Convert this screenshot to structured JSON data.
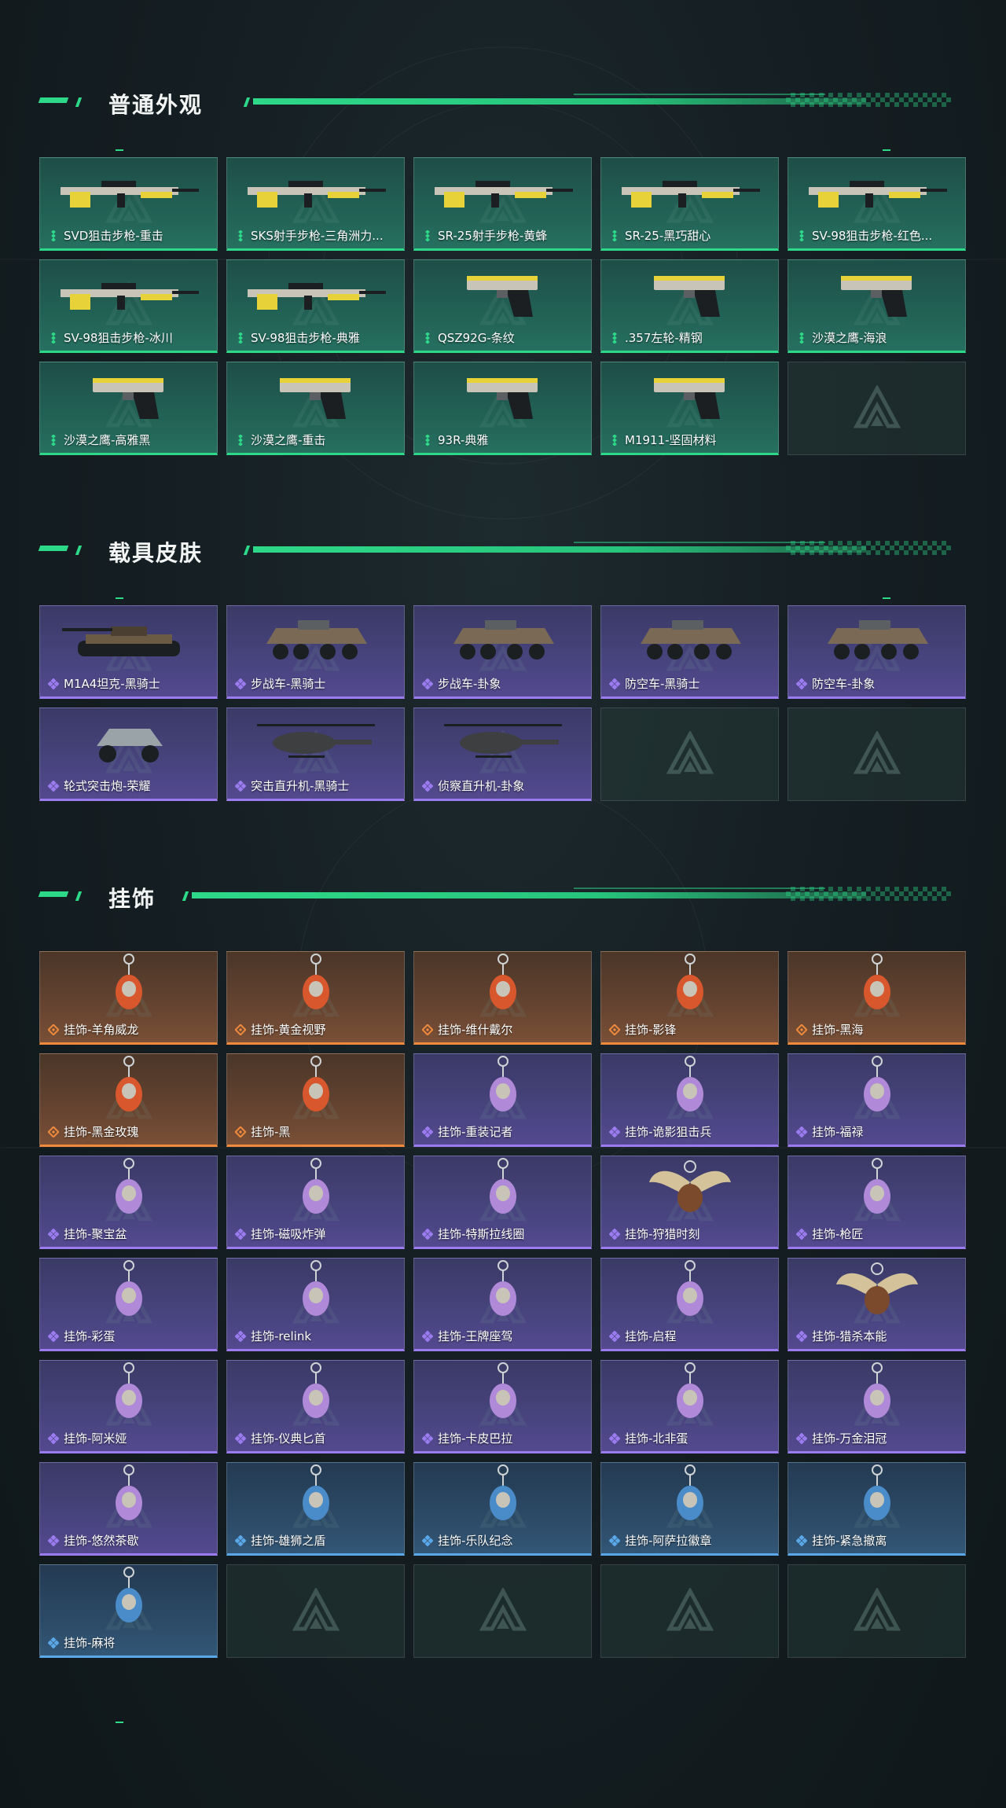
{
  "sections": [
    {
      "title": "普通外观",
      "items": [
        {
          "label": "SVD狙击步枪-重击",
          "rarity": "green",
          "icon": "rifle-icon"
        },
        {
          "label": "SKS射手步枪-三角洲力...",
          "rarity": "green",
          "icon": "rifle-icon"
        },
        {
          "label": "SR-25射手步枪-黄蜂",
          "rarity": "green",
          "icon": "rifle-icon"
        },
        {
          "label": "SR-25-黑巧甜心",
          "rarity": "green",
          "icon": "rifle-icon"
        },
        {
          "label": "SV-98狙击步枪-红色...",
          "rarity": "green",
          "icon": "rifle-icon"
        },
        {
          "label": "SV-98狙击步枪-冰川",
          "rarity": "green",
          "icon": "rifle-icon"
        },
        {
          "label": "SV-98狙击步枪-典雅",
          "rarity": "green",
          "icon": "rifle-icon"
        },
        {
          "label": "QSZ92G-条纹",
          "rarity": "green",
          "icon": "pistol-icon"
        },
        {
          "label": ".357左轮-精钢",
          "rarity": "green",
          "icon": "revolver-icon"
        },
        {
          "label": "沙漠之鹰-海浪",
          "rarity": "green",
          "icon": "pistol-icon"
        },
        {
          "label": "沙漠之鹰-高雅黑",
          "rarity": "green",
          "icon": "pistol-icon"
        },
        {
          "label": "沙漠之鹰-重击",
          "rarity": "green",
          "icon": "pistol-icon"
        },
        {
          "label": "93R-典雅",
          "rarity": "green",
          "icon": "pistol-icon"
        },
        {
          "label": "M1911-坚固材料",
          "rarity": "green",
          "icon": "pistol-icon"
        },
        {
          "label": "",
          "rarity": "empty",
          "icon": "logo-watermark-icon"
        }
      ]
    },
    {
      "title": "载具皮肤",
      "items": [
        {
          "label": "M1A4坦克-黑骑士",
          "rarity": "purple",
          "icon": "tank-icon"
        },
        {
          "label": "步战车-黑骑士",
          "rarity": "purple",
          "icon": "armored-vehicle-icon"
        },
        {
          "label": "步战车-卦象",
          "rarity": "purple",
          "icon": "armored-vehicle-icon"
        },
        {
          "label": "防空车-黑骑士",
          "rarity": "purple",
          "icon": "armored-vehicle-icon"
        },
        {
          "label": "防空车-卦象",
          "rarity": "purple",
          "icon": "armored-vehicle-icon"
        },
        {
          "label": "轮式突击炮-荣耀",
          "rarity": "purple",
          "icon": "buggy-icon"
        },
        {
          "label": "突击直升机-黑骑士",
          "rarity": "purple",
          "icon": "helicopter-icon"
        },
        {
          "label": "侦察直升机-卦象",
          "rarity": "purple",
          "icon": "helicopter-icon"
        },
        {
          "label": "",
          "rarity": "empty",
          "icon": "logo-watermark-icon"
        },
        {
          "label": "",
          "rarity": "empty",
          "icon": "logo-watermark-icon"
        }
      ]
    },
    {
      "title": "挂饰",
      "items": [
        {
          "label": "挂饰-羊角威龙",
          "rarity": "orange",
          "icon": "charm-icon"
        },
        {
          "label": "挂饰-黄金视野",
          "rarity": "orange",
          "icon": "charm-icon"
        },
        {
          "label": "挂饰-维什戴尔",
          "rarity": "orange",
          "icon": "charm-icon"
        },
        {
          "label": "挂饰-影锋",
          "rarity": "orange",
          "icon": "charm-icon"
        },
        {
          "label": "挂饰-黑海",
          "rarity": "orange",
          "icon": "charm-icon"
        },
        {
          "label": "挂饰-黑金玫瑰",
          "rarity": "orange",
          "icon": "charm-icon"
        },
        {
          "label": "挂饰-黑",
          "rarity": "orange",
          "icon": "charm-icon"
        },
        {
          "label": "挂饰-重装记者",
          "rarity": "purple",
          "icon": "charm-icon"
        },
        {
          "label": "挂饰-诡影狙击兵",
          "rarity": "purple",
          "icon": "charm-icon"
        },
        {
          "label": "挂饰-福禄",
          "rarity": "purple",
          "icon": "charm-icon"
        },
        {
          "label": "挂饰-聚宝盆",
          "rarity": "purple",
          "icon": "charm-icon"
        },
        {
          "label": "挂饰-磁吸炸弹",
          "rarity": "purple",
          "icon": "charm-icon"
        },
        {
          "label": "挂饰-特斯拉线圈",
          "rarity": "purple",
          "icon": "charm-icon"
        },
        {
          "label": "挂饰-狩猎时刻",
          "rarity": "purple",
          "icon": "antler-charm-icon"
        },
        {
          "label": "挂饰-枪匠",
          "rarity": "purple",
          "icon": "charm-icon"
        },
        {
          "label": "挂饰-彩蛋",
          "rarity": "purple",
          "icon": "charm-icon"
        },
        {
          "label": "挂饰-relink",
          "rarity": "purple",
          "icon": "charm-icon"
        },
        {
          "label": "挂饰-王牌座驾",
          "rarity": "purple",
          "icon": "charm-icon"
        },
        {
          "label": "挂饰-启程",
          "rarity": "purple",
          "icon": "charm-icon"
        },
        {
          "label": "挂饰-猎杀本能",
          "rarity": "purple",
          "icon": "antler-charm-icon"
        },
        {
          "label": "挂饰-阿米娅",
          "rarity": "purple",
          "icon": "charm-icon"
        },
        {
          "label": "挂饰-仪典匕首",
          "rarity": "purple",
          "icon": "charm-icon"
        },
        {
          "label": "挂饰-卡皮巴拉",
          "rarity": "purple",
          "icon": "charm-icon"
        },
        {
          "label": "挂饰-北非蛋",
          "rarity": "purple",
          "icon": "charm-icon"
        },
        {
          "label": "挂饰-万金泪冠",
          "rarity": "purple",
          "icon": "charm-icon"
        },
        {
          "label": "挂饰-悠然茶歇",
          "rarity": "purple",
          "icon": "charm-icon"
        },
        {
          "label": "挂饰-雄狮之盾",
          "rarity": "blue",
          "icon": "charm-icon"
        },
        {
          "label": "挂饰-乐队纪念",
          "rarity": "blue",
          "icon": "charm-icon"
        },
        {
          "label": "挂饰-阿萨拉徽章",
          "rarity": "blue",
          "icon": "charm-icon"
        },
        {
          "label": "挂饰-紧急撤离",
          "rarity": "blue",
          "icon": "charm-icon"
        },
        {
          "label": "挂饰-麻将",
          "rarity": "blue",
          "icon": "charm-icon"
        },
        {
          "label": "",
          "rarity": "empty",
          "icon": "logo-watermark-icon"
        },
        {
          "label": "",
          "rarity": "empty",
          "icon": "logo-watermark-icon"
        },
        {
          "label": "",
          "rarity": "empty",
          "icon": "logo-watermark-icon"
        },
        {
          "label": "",
          "rarity": "empty",
          "icon": "logo-watermark-icon"
        }
      ]
    }
  ],
  "colors": {
    "accent": "#2ed889",
    "green": "#2ed889",
    "purple": "#9b7cf0",
    "orange": "#f08a3c",
    "blue": "#5aa8e8"
  }
}
